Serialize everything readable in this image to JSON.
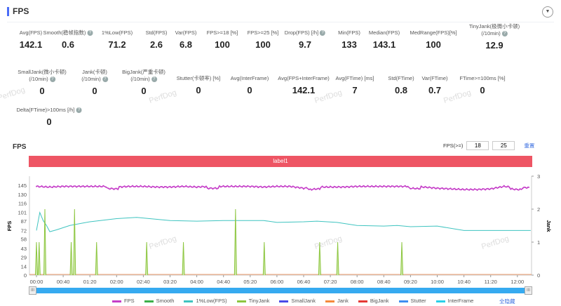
{
  "header": {
    "title": "FPS",
    "collapse_icon": "chevron-down-icon"
  },
  "metrics": [
    {
      "label": "Avg(FPS)",
      "value": "142.1"
    },
    {
      "label": "Smooth(稳帧指数)",
      "value": "0.6",
      "help": true
    },
    {
      "label": "1%Low(FPS)",
      "value": "71.2"
    },
    {
      "label": "Std(FPS)",
      "value": "2.6"
    },
    {
      "label": "Var(FPS)",
      "value": "6.8"
    },
    {
      "label": "FPS>=18 [%]",
      "value": "100"
    },
    {
      "label": "FPS>=25 [%]",
      "value": "100"
    },
    {
      "label": "Drop(FPS) [/h]",
      "value": "9.7",
      "help": true
    },
    {
      "label": "Min(FPS)",
      "value": "133"
    },
    {
      "label": "Median(FPS)",
      "value": "143.1"
    },
    {
      "label": "MedRange(FPS)[%]",
      "value": "100"
    },
    {
      "label": "TinyJank(极微小卡顿)",
      "label2": "(/10min)",
      "value": "12.9",
      "help": true
    },
    {
      "label": "SmallJank(微小卡顿)",
      "label2": "(/10min)",
      "value": "0",
      "help": true
    },
    {
      "label": "Jank(卡顿)",
      "label2": "(/10min)",
      "value": "0",
      "help": true
    },
    {
      "label": "BigJank(严重卡顿)",
      "label2": "(/10min)",
      "value": "0",
      "help": true
    },
    {
      "label": "Stutter(卡顿率) [%]",
      "value": "0"
    },
    {
      "label": "Avg(InterFrame)",
      "value": "0"
    },
    {
      "label": "Avg(FPS+InterFrame)",
      "value": "142.1"
    },
    {
      "label": "Avg(FTime) [ms]",
      "value": "7"
    },
    {
      "label": "Std(FTime)",
      "value": "0.8"
    },
    {
      "label": "Var(FTime)",
      "value": "0.7"
    },
    {
      "label": "FTime>=100ms [%]",
      "value": "0"
    },
    {
      "label": "Delta(FTime)>100ms [/h]",
      "value": "0",
      "help": true
    }
  ],
  "chart_controls": {
    "title": "FPS",
    "fps_label": "FPS(>=)",
    "fps_min1": "18",
    "fps_min2": "25",
    "reset": "重置",
    "band_label": "label1",
    "hide_all": "全隐藏"
  },
  "watermark": "PerfDog",
  "chart_data": {
    "type": "line",
    "ylabel": "FPS",
    "y2label": "Jank",
    "yticks": [
      0,
      14,
      29,
      43,
      58,
      72,
      87,
      101,
      116,
      130,
      145
    ],
    "ylim": [
      0,
      159.5
    ],
    "y2ticks": [
      0,
      1,
      2,
      3
    ],
    "y2lim": [
      0,
      3
    ],
    "xticks": [
      "00:00",
      "00:40",
      "01:20",
      "02:00",
      "02:40",
      "03:20",
      "04:00",
      "04:40",
      "05:20",
      "06:00",
      "06:40",
      "07:20",
      "08:00",
      "08:40",
      "09:20",
      "10:00",
      "10:40",
      "11:20",
      "12:00"
    ],
    "xlim_seconds": [
      0,
      750
    ],
    "series": [
      {
        "name": "FPS",
        "color": "#c53ec8",
        "axis": "left",
        "t": [
          0,
          20,
          40,
          60,
          80,
          100,
          120,
          140,
          160,
          180,
          200,
          220,
          240,
          260,
          280,
          300,
          320,
          340,
          360,
          380,
          400,
          420,
          440,
          460,
          480,
          500,
          520,
          540,
          560,
          580,
          600,
          620,
          640,
          660,
          680,
          700,
          720,
          740
        ],
        "v": [
          143,
          142,
          143,
          143,
          143,
          143,
          142,
          143,
          143,
          142,
          142,
          143,
          142,
          143,
          143,
          143,
          143,
          142,
          143,
          143,
          140,
          142,
          142,
          142,
          143,
          143,
          143,
          143,
          143,
          142,
          140,
          139,
          138,
          138,
          139,
          143,
          141,
          141
        ]
      },
      {
        "name": "Smooth",
        "color": "#3cb04a",
        "axis": "left",
        "t": [],
        "v": []
      },
      {
        "name": "1%Low(FPS)",
        "color": "#3fc4c0",
        "axis": "left",
        "t": [
          0,
          5,
          10,
          15,
          20,
          30,
          50,
          80,
          120,
          150,
          200,
          240,
          280,
          340,
          360,
          400,
          420,
          450,
          480,
          520,
          540,
          560,
          600,
          640,
          680,
          740
        ],
        "v": [
          72,
          101,
          88,
          80,
          70,
          73,
          80,
          86,
          91,
          93,
          88,
          87,
          88,
          88,
          85,
          86,
          87,
          85,
          80,
          79,
          80,
          78,
          79,
          72,
          72,
          72
        ]
      },
      {
        "name": "TinyJank",
        "color": "#8cc63f",
        "axis": "right",
        "t": [
          0,
          4,
          12.6,
          52,
          57,
          90,
          165,
          220,
          298,
          341,
          424,
          451,
          547
        ],
        "v": [
          1,
          1,
          2,
          1,
          2,
          1,
          1,
          1,
          2,
          1,
          1,
          1,
          1
        ]
      },
      {
        "name": "SmallJank",
        "color": "#4a4ae8",
        "axis": "right",
        "t": [],
        "v": []
      },
      {
        "name": "Jank",
        "color": "#f58a3c",
        "axis": "right",
        "t": [],
        "v": []
      },
      {
        "name": "BigJank",
        "color": "#e53935",
        "axis": "right",
        "t": [],
        "v": []
      },
      {
        "name": "Stutter",
        "color": "#3f8ef0",
        "axis": "right",
        "t": [],
        "v": []
      },
      {
        "name": "InterFrame",
        "color": "#2ad0e8",
        "axis": "right",
        "t": [],
        "v": []
      }
    ]
  }
}
